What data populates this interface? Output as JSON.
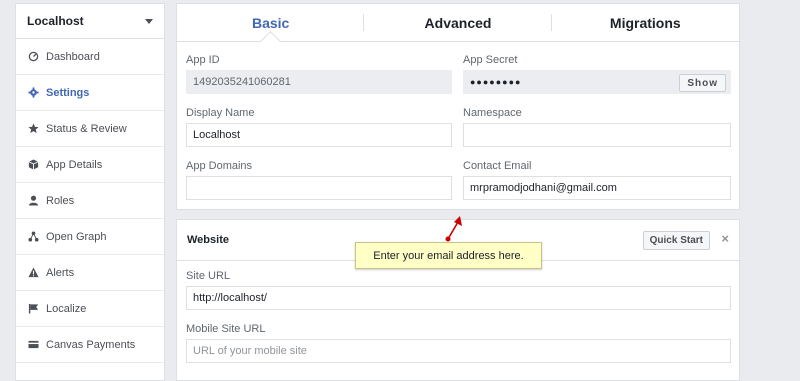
{
  "sidebar": {
    "app_name": "Localhost",
    "items": [
      {
        "label": "Dashboard",
        "icon": "dashboard-icon",
        "active": false
      },
      {
        "label": "Settings",
        "icon": "gear-icon",
        "active": true
      },
      {
        "label": "Status & Review",
        "icon": "star-icon",
        "active": false
      },
      {
        "label": "App Details",
        "icon": "cube-icon",
        "active": false
      },
      {
        "label": "Roles",
        "icon": "person-icon",
        "active": false
      },
      {
        "label": "Open Graph",
        "icon": "graph-icon",
        "active": false
      },
      {
        "label": "Alerts",
        "icon": "warning-icon",
        "active": false
      },
      {
        "label": "Localize",
        "icon": "flag-icon",
        "active": false
      },
      {
        "label": "Canvas Payments",
        "icon": "credit-card-icon",
        "active": false
      }
    ]
  },
  "tabs": [
    {
      "label": "Basic",
      "active": true
    },
    {
      "label": "Advanced",
      "active": false
    },
    {
      "label": "Migrations",
      "active": false
    }
  ],
  "basic": {
    "app_id_label": "App ID",
    "app_id_value": "1492035241060281",
    "app_secret_label": "App Secret",
    "app_secret_value": "●●●●●●●●",
    "show_button": "Show",
    "display_name_label": "Display Name",
    "display_name_value": "Localhost",
    "namespace_label": "Namespace",
    "namespace_value": "",
    "app_domains_label": "App Domains",
    "app_domains_value": "",
    "contact_email_label": "Contact Email",
    "contact_email_value": "mrpramodjodhani@gmail.com"
  },
  "website": {
    "title": "Website",
    "quick_start": "Quick Start",
    "close_symbol": "×",
    "site_url_label": "Site URL",
    "site_url_value": "http://localhost/",
    "mobile_site_url_label": "Mobile Site URL",
    "mobile_site_url_placeholder": "URL of your mobile site"
  },
  "annotation": {
    "tooltip_text": "Enter your email address here.",
    "arrow_color": "#cc0000"
  },
  "colors": {
    "accent": "#4267b2",
    "background": "#e9ebee",
    "tooltip_bg": "#ffffc6"
  }
}
